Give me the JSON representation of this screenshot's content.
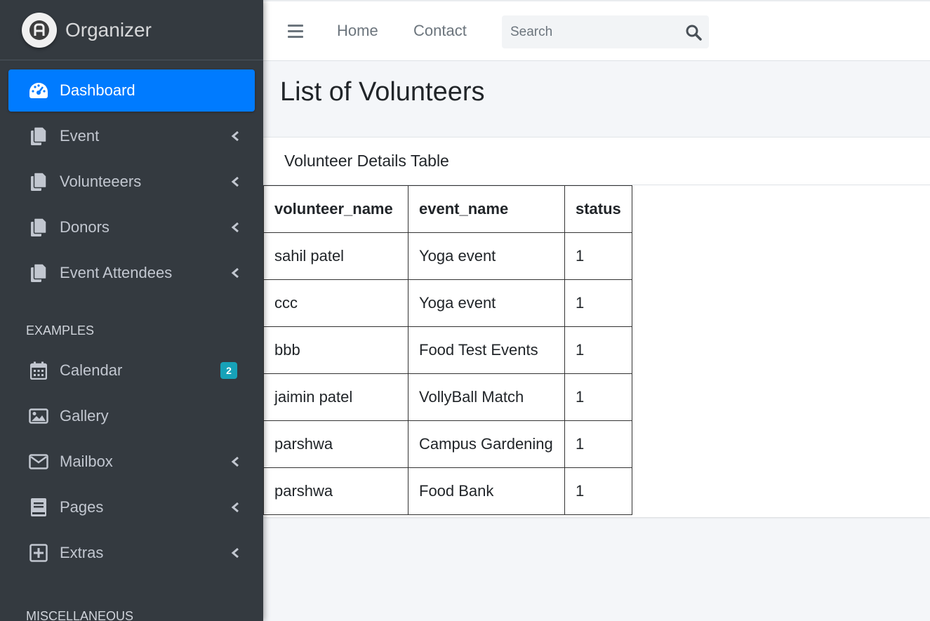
{
  "brand": {
    "name": "Organizer"
  },
  "sidebar": {
    "items": [
      {
        "label": "Dashboard",
        "icon": "tachometer-icon",
        "active": true
      },
      {
        "label": "Event",
        "icon": "copy-icon"
      },
      {
        "label": "Volunteeers",
        "icon": "copy-icon"
      },
      {
        "label": "Donors",
        "icon": "copy-icon"
      },
      {
        "label": "Event Attendees",
        "icon": "copy-icon"
      }
    ],
    "examples_header": "EXAMPLES",
    "examples": [
      {
        "label": "Calendar",
        "icon": "calendar-icon",
        "badge": "2"
      },
      {
        "label": "Gallery",
        "icon": "image-icon"
      },
      {
        "label": "Mailbox",
        "icon": "envelope-icon"
      },
      {
        "label": "Pages",
        "icon": "book-icon"
      },
      {
        "label": "Extras",
        "icon": "plus-square-icon"
      }
    ],
    "misc_header": "MISCELLANEOUS"
  },
  "topbar": {
    "links": [
      "Home",
      "Contact"
    ],
    "search_placeholder": "Search"
  },
  "main": {
    "title": "List of Volunteers",
    "card_title": "Volunteer Details Table",
    "table": {
      "headers": [
        "volunteer_name",
        "event_name",
        "status"
      ],
      "rows": [
        [
          "sahil patel",
          "Yoga event",
          "1"
        ],
        [
          "ccc",
          "Yoga event",
          "1"
        ],
        [
          "bbb",
          "Food Test Events",
          "1"
        ],
        [
          "jaimin patel",
          "VollyBall Match",
          "1"
        ],
        [
          "parshwa",
          "Campus Gardening",
          "1"
        ],
        [
          "parshwa",
          "Food Bank",
          "1"
        ]
      ]
    }
  },
  "colors": {
    "sidebar_bg": "#343a40",
    "active_bg": "#007bff",
    "badge_bg": "#17a2b8",
    "content_bg": "#f4f6f9"
  }
}
